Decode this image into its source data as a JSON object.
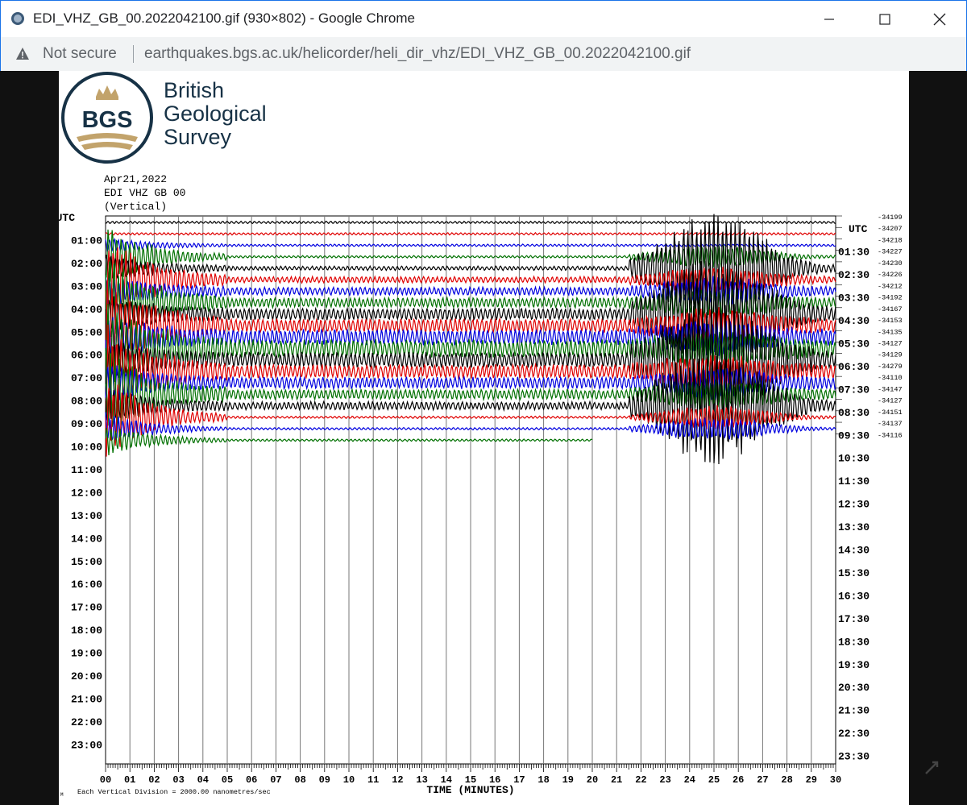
{
  "window": {
    "title": "EDI_VHZ_GB_00.2022042100.gif (930×802) - Google Chrome"
  },
  "address": {
    "security": "Not secure",
    "url": "earthquakes.bgs.ac.uk/helicorder/heli_dir_vhz/EDI_VHZ_GB_00.2022042100.gif"
  },
  "brand": {
    "logo_text": "BGS",
    "line1": "British",
    "line2": "Geological",
    "line3": "Survey"
  },
  "meta": {
    "date": "Apr21,2022",
    "station": "EDI VHZ GB 00",
    "component": "(Vertical)"
  },
  "helicorder": {
    "left_labels": [
      "UTC",
      "01:00",
      "02:00",
      "03:00",
      "04:00",
      "05:00",
      "06:00",
      "07:00",
      "08:00",
      "09:00",
      "10:00",
      "11:00",
      "12:00",
      "13:00",
      "14:00",
      "15:00",
      "16:00",
      "17:00",
      "18:00",
      "19:00",
      "20:00",
      "21:00",
      "22:00",
      "23:00"
    ],
    "right_labels": [
      "UTC",
      "01:30",
      "02:30",
      "03:30",
      "04:30",
      "05:30",
      "06:30",
      "07:30",
      "08:30",
      "09:30",
      "10:30",
      "11:30",
      "12:30",
      "13:30",
      "14:30",
      "15:30",
      "16:30",
      "17:30",
      "18:30",
      "19:30",
      "20:30",
      "21:30",
      "22:30",
      "23:30"
    ],
    "trace_values": [
      "-34199",
      "-34207",
      "-34218",
      "-34227",
      "-34230",
      "-34226",
      "-34212",
      "-34192",
      "-34167",
      "-34153",
      "-34135",
      "-34127",
      "-34129",
      "-34279",
      "-34110",
      "-34147",
      "-34127",
      "-34151",
      "-34137",
      "-34116"
    ],
    "x_ticks": [
      "00",
      "01",
      "02",
      "03",
      "04",
      "05",
      "06",
      "07",
      "08",
      "09",
      "10",
      "11",
      "12",
      "13",
      "14",
      "15",
      "16",
      "17",
      "18",
      "19",
      "20",
      "21",
      "22",
      "23",
      "24",
      "25",
      "26",
      "27",
      "28",
      "29",
      "30"
    ],
    "x_label": "TIME (MINUTES)",
    "footer_note": "Each Vertical Division = 2000.00 nanometres/sec",
    "footer_mark": "M",
    "trace_colors": [
      "#000000",
      "#e00000",
      "#0000e0",
      "#007000"
    ]
  }
}
